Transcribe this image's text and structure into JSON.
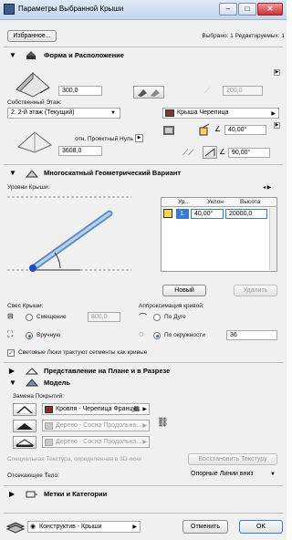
{
  "window": {
    "title": "Параметры Выбранной Крыши",
    "min_glyph": "–",
    "max_glyph": "□",
    "close_glyph": "✕"
  },
  "toolbar": {
    "favorites_label": "Избранное...",
    "selected_info": "Выбрано: 1 Редактируемых: 1"
  },
  "shape_section": {
    "title": "Форма и Расположение",
    "thickness_value": "300,0",
    "own_floor_label": "Собственный Этаж:",
    "floor_value": "2. 2-й этаж (Текущий)",
    "angle_field_value": "200,0",
    "material_value": "Крыша Черепица",
    "reference_label": "отн. Проектный Нуль",
    "reference_arrow": "▶",
    "elevation_value": "3608,0",
    "angle1_value": "40,00°",
    "angle2_value": "90,00°"
  },
  "multi_section": {
    "title": "Многоскатный Геометрический Вариант",
    "roof_levels_label": "Уровни Крыши:",
    "table_headers": [
      "Ур...",
      "Уклон",
      "Высота"
    ],
    "table_rows": [
      {
        "level": "1.",
        "slope": "40,00°",
        "height": "20000,0"
      }
    ],
    "new_button": "Новый",
    "delete_button": "Удалить",
    "overhang_label": "Свес Крыши:",
    "offset_option": "Смещение",
    "offset_value": "800,0",
    "manual_option": "Вручную",
    "curve_label": "Аппроксимация кривой:",
    "by_arc_option": "По Дуге",
    "by_circle_option": "По окружности",
    "segments_value": "36",
    "skylight_check_label": "Световые Люки трактуют сегменты как кривые"
  },
  "plan_section": {
    "title": "Представление на Плане и в Разрезе"
  },
  "model_section": {
    "title": "Модель",
    "override_label": "Замена Покрытий:",
    "surfaces": [
      {
        "name": "Кровля - Черепица Францу...",
        "color": "#8b2a2a",
        "enabled": true
      },
      {
        "name": "Дерево - Сосна Продольна...",
        "color": "#c9c9c9",
        "enabled": false
      },
      {
        "name": "Дерево - Сосна Продольна...",
        "color": "#c9c9c9",
        "enabled": false
      }
    ],
    "special_texture_label": "Специальная Текстура, определенная в 3D-окне",
    "restore_texture_button": "Восстановить Текстуру",
    "trim_body_label": "Отсекающее Тело:",
    "trim_body_value": "Опорные Линии вниз"
  },
  "tags_section": {
    "title": "Метки и Категории"
  },
  "footer": {
    "layer_value": "Конструктив - Крыши",
    "cancel_button": "Отменить",
    "ok_button": "OK"
  },
  "colors": {
    "accent_blue": "#3c78d8",
    "roof_tile": "#8b2a2a"
  }
}
